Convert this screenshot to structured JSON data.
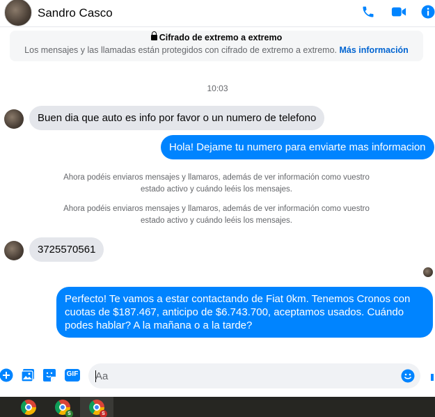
{
  "header": {
    "contact_name": "Sandro Casco",
    "icons": [
      "phone-icon",
      "video-icon",
      "info-icon"
    ],
    "accent_color": "#0084ff"
  },
  "encryption": {
    "title": "Cifrado de extremo a extremo",
    "text": "Los mensajes y las llamadas están protegidos con cifrado de extremo a extremo.",
    "link": "Más información"
  },
  "timestamp": "10:03",
  "messages": [
    {
      "type": "incoming",
      "text": "Buen dia que auto es info por favor o un numero de telefono"
    },
    {
      "type": "outgoing",
      "text": "Hola! Dejame tu numero para enviarte mas informacion"
    },
    {
      "type": "system",
      "text": "Ahora podéis enviaros mensajes y llamaros, además de ver información como vuestro estado activo y cuándo leéis los mensajes."
    },
    {
      "type": "system",
      "text": "Ahora podéis enviaros mensajes y llamaros, además de ver información como vuestro estado activo y cuándo leéis los mensajes."
    },
    {
      "type": "incoming",
      "text": "3725570561"
    },
    {
      "type": "outgoing",
      "text": "Perfecto! Te vamos a estar contactando de Fiat 0km. Tenemos Cronos con cuotas de $187.467, anticipo de $6.743.700, aceptamos usados. Cuándo podes hablar? A la mañana o a la tarde?"
    }
  ],
  "composer": {
    "placeholder": "Aa",
    "gif_label": "GIF",
    "icons": [
      "plus-icon",
      "image-icon",
      "sticker-icon",
      "gif-icon",
      "emoji-icon",
      "like-icon"
    ]
  },
  "taskbar": {
    "items": [
      {
        "icon": "chrome-icon",
        "badge": ""
      },
      {
        "icon": "chrome-icon",
        "badge": "S"
      },
      {
        "icon": "chrome-icon",
        "badge": "S"
      }
    ]
  }
}
